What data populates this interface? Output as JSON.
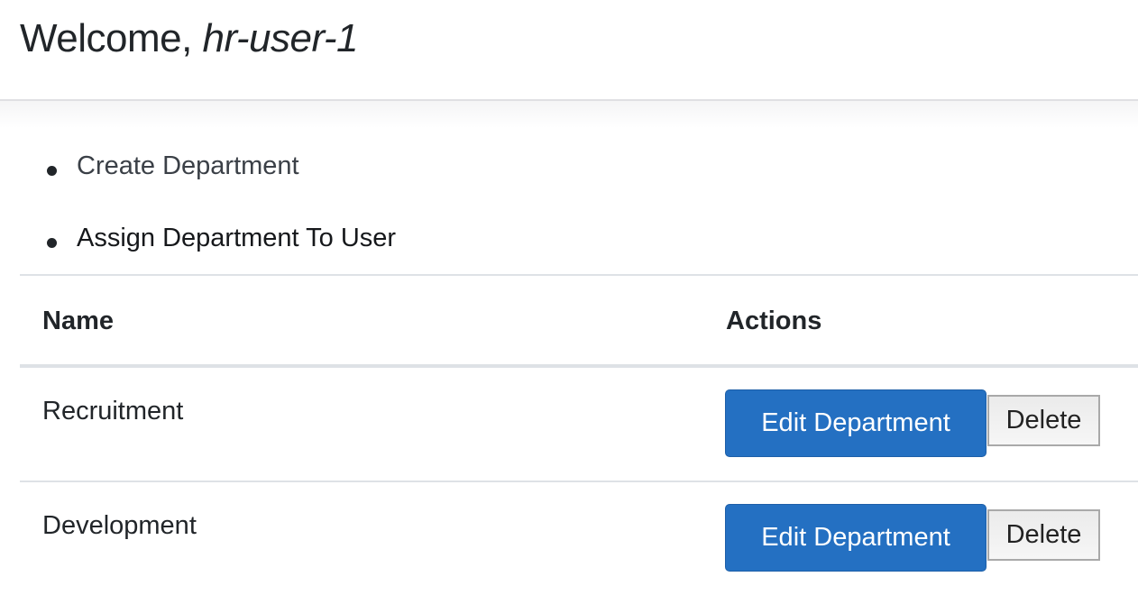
{
  "header": {
    "welcome": "Welcome,",
    "username": "hr-user-1"
  },
  "links": [
    "Create Department",
    "Assign Department To User"
  ],
  "table": {
    "columns": [
      "Name",
      "Actions"
    ],
    "rows": [
      {
        "name": "Recruitment",
        "edit_label": "Edit Department",
        "delete_label": "Delete"
      },
      {
        "name": "Development",
        "edit_label": "Edit Department",
        "delete_label": "Delete"
      }
    ]
  },
  "colors": {
    "primary_button": "#2470c2"
  }
}
